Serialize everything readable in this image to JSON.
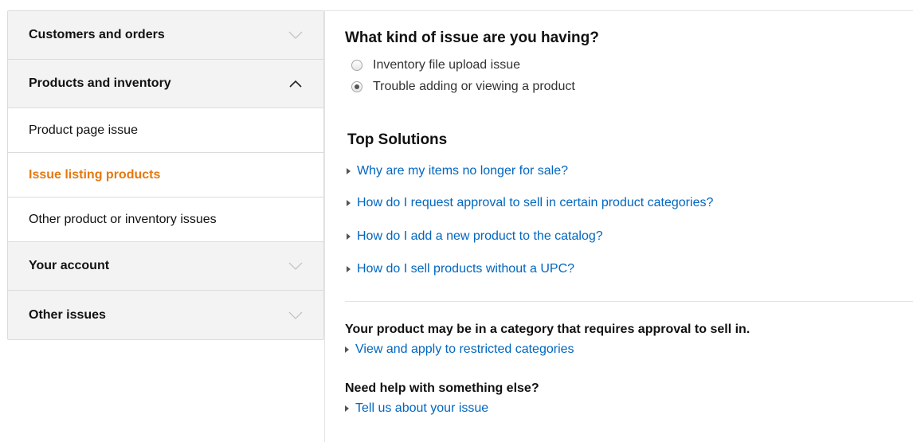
{
  "sidebar": {
    "cat_customers": "Customers and orders",
    "cat_products": "Products and inventory",
    "sub_items": [
      "Product page issue",
      "Issue listing products",
      "Other product or inventory issues"
    ],
    "cat_account": "Your account",
    "cat_other": "Other issues"
  },
  "main": {
    "question": "What kind of issue are you having?",
    "options": [
      "Inventory file upload issue",
      "Trouble adding or viewing a product"
    ],
    "selected_option_index": 1,
    "solutions_title": "Top Solutions",
    "solutions": [
      "Why are my items no longer for sale?",
      "How do I request approval to sell in certain product categories?",
      "How do I add a new product to the catalog?",
      "How do I sell products without a UPC?"
    ],
    "category_note": "Your product may be in a category that requires approval to sell in.",
    "category_link": "View and apply to restricted categories",
    "help_title": "Need help with something else?",
    "help_link": "Tell us about your issue"
  },
  "colors": {
    "link": "#0066c0",
    "active": "#e47911",
    "category_bg": "#f3f3f3"
  }
}
